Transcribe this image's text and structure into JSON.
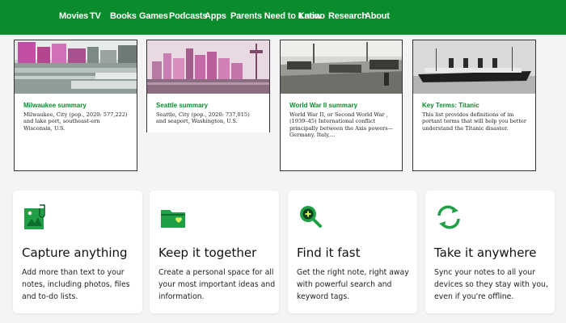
{
  "nav": {
    "items": [
      "Movies",
      "TV",
      "Books",
      "Games",
      "Podcasts",
      "Apps",
      "Parents Need to Know",
      "Latino",
      "Research",
      "About"
    ]
  },
  "articles": [
    {
      "title": "Milwaukee summary",
      "text": "Milwaukee, City (pop., 2020: 577,222) and lake port, southeast-ern Wisconsin, U.S."
    },
    {
      "title": "Seattle summary",
      "text": "Seattle, City (pop., 2020: 737,015) and seaport, Washington, U.S."
    },
    {
      "title": "World War II summary",
      "text": "World War II, or Second World War , (1939–45) International conflict principally between the Axis powers—Germany, Italy,..."
    },
    {
      "title": "Key Terms: Titanic",
      "text": "This list provides definitions of im portant terms that will help you better understand the Titanic disaster."
    }
  ],
  "features": [
    {
      "icon": "image-clip-icon",
      "title": "Capture anything",
      "desc": "Add more than text to your notes, including photos, files and to-do lists."
    },
    {
      "icon": "folder-heart-icon",
      "title": "Keep it together",
      "desc": "Create a personal space for all your most important ideas and information."
    },
    {
      "icon": "search-plus-icon",
      "title": "Find it fast",
      "desc": "Get the right note, right away with powerful search and keyword tags."
    },
    {
      "icon": "sync-icon",
      "title": "Take it anywhere",
      "desc": "Sync your notes to all your devices so they stay with you, even if you're offline."
    }
  ],
  "colors": {
    "brand_green": "#0a8c2c",
    "icon_green": "#1fa046"
  }
}
